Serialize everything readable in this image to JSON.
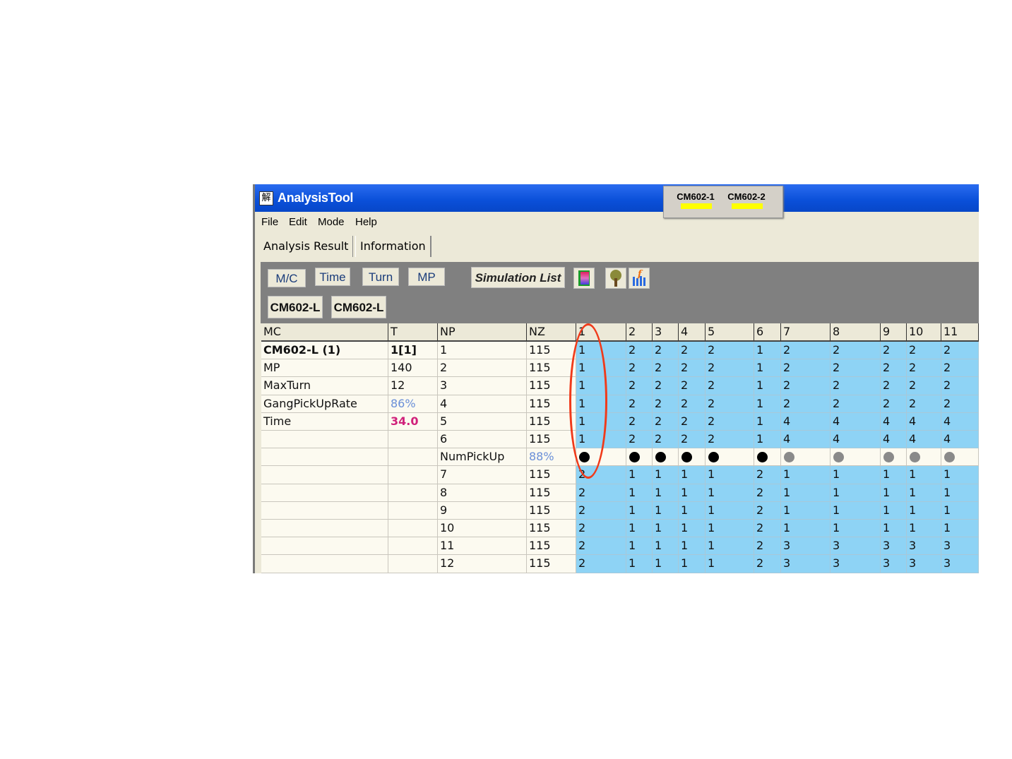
{
  "window": {
    "title": "AnalysisTool",
    "app_icon": "解"
  },
  "machine_buttons": [
    {
      "label": "CM602-1",
      "indicator_color": "#ffff00"
    },
    {
      "label": "CM602-2",
      "indicator_color": "#ffff00"
    }
  ],
  "menu": [
    "File",
    "Edit",
    "Mode",
    "Help"
  ],
  "tabs": [
    {
      "label": "Analysis Result",
      "active": true
    },
    {
      "label": "Information",
      "active": false
    }
  ],
  "toolbar": {
    "view_buttons": [
      "M/C",
      "Time",
      "Turn",
      "MP"
    ],
    "simulation_list": "Simulation List",
    "icons": [
      "color-bar-icon",
      "tree-icon",
      "chart-icon"
    ],
    "machine_tabs": [
      "CM602-L",
      "CM602-L"
    ]
  },
  "grid": {
    "headers": [
      "MC",
      "T",
      "NP",
      "NZ",
      "1",
      "2",
      "3",
      "4",
      "5",
      "6",
      "7",
      "8",
      "9",
      "10",
      "11"
    ],
    "rows": [
      {
        "mc": "CM602-L (1)",
        "t": "1[1]",
        "np": "1",
        "nz": "115",
        "values": [
          "1",
          "2",
          "2",
          "2",
          "2",
          "1",
          "2",
          "2",
          "2",
          "2",
          "2"
        ]
      },
      {
        "mc": "MP",
        "t": "140",
        "np": "2",
        "nz": "115",
        "values": [
          "1",
          "2",
          "2",
          "2",
          "2",
          "1",
          "2",
          "2",
          "2",
          "2",
          "2"
        ]
      },
      {
        "mc": "MaxTurn",
        "t": "12",
        "np": "3",
        "nz": "115",
        "values": [
          "1",
          "2",
          "2",
          "2",
          "2",
          "1",
          "2",
          "2",
          "2",
          "2",
          "2"
        ]
      },
      {
        "mc": "GangPickUpRate",
        "t": "86%",
        "np": "4",
        "nz": "115",
        "values": [
          "1",
          "2",
          "2",
          "2",
          "2",
          "1",
          "2",
          "2",
          "2",
          "2",
          "2"
        ]
      },
      {
        "mc": "Time",
        "t": "34.0",
        "np": "5",
        "nz": "115",
        "values": [
          "1",
          "2",
          "2",
          "2",
          "2",
          "1",
          "4",
          "4",
          "4",
          "4",
          "4"
        ]
      },
      {
        "mc": "",
        "t": "",
        "np": "6",
        "nz": "115",
        "values": [
          "1",
          "2",
          "2",
          "2",
          "2",
          "1",
          "4",
          "4",
          "4",
          "4",
          "4"
        ]
      },
      {
        "mc": "",
        "t": "",
        "np": "NumPickUp",
        "nz": "88%",
        "dots": [
          "black",
          "black",
          "black",
          "black",
          "black",
          "black",
          "gray",
          "gray",
          "gray",
          "gray",
          "gray"
        ]
      },
      {
        "mc": "",
        "t": "",
        "np": "7",
        "nz": "115",
        "values": [
          "2",
          "1",
          "1",
          "1",
          "1",
          "2",
          "1",
          "1",
          "1",
          "1",
          "1"
        ]
      },
      {
        "mc": "",
        "t": "",
        "np": "8",
        "nz": "115",
        "values": [
          "2",
          "1",
          "1",
          "1",
          "1",
          "2",
          "1",
          "1",
          "1",
          "1",
          "1"
        ]
      },
      {
        "mc": "",
        "t": "",
        "np": "9",
        "nz": "115",
        "values": [
          "2",
          "1",
          "1",
          "1",
          "1",
          "2",
          "1",
          "1",
          "1",
          "1",
          "1"
        ]
      },
      {
        "mc": "",
        "t": "",
        "np": "10",
        "nz": "115",
        "values": [
          "2",
          "1",
          "1",
          "1",
          "1",
          "2",
          "1",
          "1",
          "1",
          "1",
          "1"
        ]
      },
      {
        "mc": "",
        "t": "",
        "np": "11",
        "nz": "115",
        "values": [
          "2",
          "1",
          "1",
          "1",
          "1",
          "2",
          "3",
          "3",
          "3",
          "3",
          "3"
        ]
      },
      {
        "mc": "",
        "t": "",
        "np": "12",
        "nz": "115",
        "values": [
          "2",
          "1",
          "1",
          "1",
          "1",
          "2",
          "3",
          "3",
          "3",
          "3",
          "3"
        ]
      }
    ]
  },
  "colors": {
    "cell_blue": "#8ed3f5",
    "rate_blue": "#6a8fd8",
    "time_magenta": "#d0207a",
    "highlight_ellipse": "#f03a1a",
    "dot_black": "#000000",
    "dot_gray": "#8a8a8a"
  }
}
